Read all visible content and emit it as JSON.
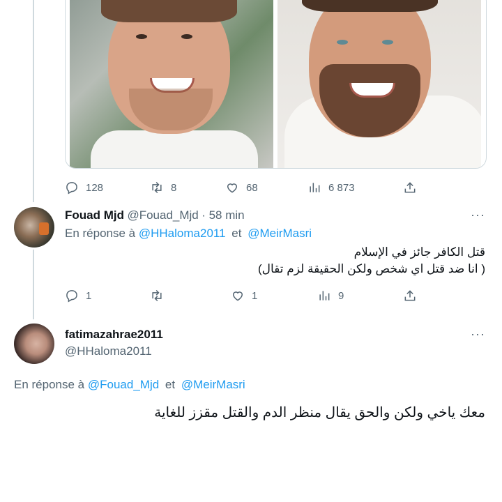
{
  "tweet1": {
    "stats": {
      "replies": "128",
      "retweets": "8",
      "likes": "68",
      "views": "6 873"
    }
  },
  "tweet2": {
    "name": "Fouad Mjd",
    "handle": "@Fouad_Mjd",
    "time": "· 58 min",
    "more": "···",
    "reply_prefix": "En réponse à",
    "reply_to_1": "@HHaloma2011",
    "reply_and": "et",
    "reply_to_2": "@MeirMasri",
    "text_line1": "قتل الكافر جائز في الإسلام",
    "text_line2": "( انا ضد قتل اي شخص ولكن الحقيقة لزم تقال)",
    "stats": {
      "replies": "1",
      "likes": "1",
      "views": "9"
    }
  },
  "tweet3": {
    "name": "fatimazahrae2011",
    "handle": "@HHaloma2011",
    "more": "···",
    "reply_prefix": "En réponse à",
    "reply_to_1": "@Fouad_Mjd",
    "reply_and": "et",
    "reply_to_2": "@MeirMasri",
    "text": "معك ياخي ولكن والحق يقال منظر الدم والقتل مقزز للغاية"
  },
  "icons": [
    "reply-icon",
    "retweet-icon",
    "like-icon",
    "views-icon",
    "share-icon"
  ],
  "colors": {
    "link": "#1d9bf0",
    "muted": "#536471",
    "line": "#cfd9de"
  }
}
